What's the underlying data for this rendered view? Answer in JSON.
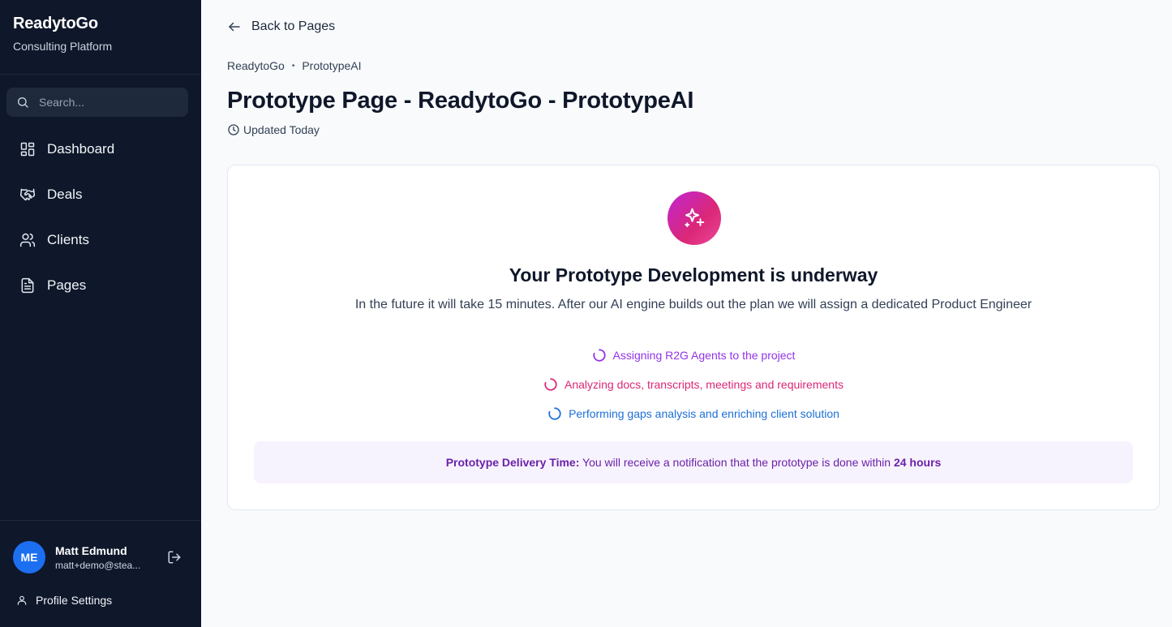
{
  "sidebar": {
    "brand_title": "ReadytoGo",
    "brand_subtitle": "Consulting Platform",
    "search_placeholder": "Search...",
    "nav": [
      {
        "label": "Dashboard",
        "icon": "dashboard-icon"
      },
      {
        "label": "Deals",
        "icon": "handshake-icon"
      },
      {
        "label": "Clients",
        "icon": "users-icon"
      },
      {
        "label": "Pages",
        "icon": "file-text-icon"
      }
    ],
    "user": {
      "initials": "ME",
      "name": "Matt Edmund",
      "email": "matt+demo@stea..."
    },
    "profile_settings": "Profile Settings"
  },
  "main": {
    "back_label": "Back to Pages",
    "breadcrumb": [
      "ReadytoGo",
      "PrototypeAI"
    ],
    "breadcrumb_separator": "•",
    "title": "Prototype Page - ReadytoGo - PrototypeAI",
    "updated": "Updated Today",
    "card": {
      "headline": "Your Prototype Development is underway",
      "subtext": "In the future it will take 15 minutes. After our AI engine builds out the plan we will assign a dedicated Product Engineer",
      "steps": [
        {
          "text": "Assigning R2G Agents to the project",
          "color": "#9333ea"
        },
        {
          "text": "Analyzing docs, transcripts, meetings and requirements",
          "color": "#db2777"
        },
        {
          "text": "Performing gaps analysis and enriching client solution",
          "color": "#1d6fd8"
        }
      ],
      "delivery_label": "Prototype Delivery Time:",
      "delivery_text": " You will receive a notification that the prototype is done within ",
      "delivery_value": "24 hours"
    }
  },
  "colors": {
    "sidebar_bg": "#0f172a",
    "avatar_bg": "#1d6ff2",
    "accent_gradient_start": "#c026d3",
    "accent_gradient_end": "#ec4899",
    "delivery_bg": "#f7f3fe",
    "delivery_text": "#6b21a8"
  }
}
